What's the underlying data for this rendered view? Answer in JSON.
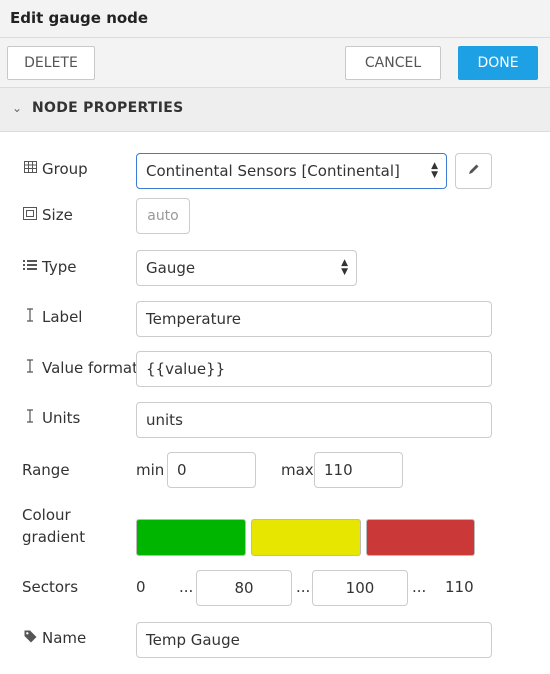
{
  "window": {
    "title": "Edit gauge node"
  },
  "toolbar": {
    "delete_label": "DELETE",
    "cancel_label": "CANCEL",
    "done_label": "DONE"
  },
  "section": {
    "title": "NODE PROPERTIES"
  },
  "group": {
    "label": "Group",
    "value": "Continental Sensors [Continental]"
  },
  "size": {
    "label": "Size",
    "value": "auto"
  },
  "type": {
    "label": "Type",
    "value": "Gauge"
  },
  "label_field": {
    "label": "Label",
    "value": "Temperature"
  },
  "value_format": {
    "label": "Value format",
    "value": "{{value}}"
  },
  "units": {
    "label": "Units",
    "value": "units"
  },
  "range": {
    "label": "Range",
    "min_label": "min",
    "min_value": "0",
    "max_label": "max",
    "max_value": "110"
  },
  "colour": {
    "label_line1": "Colour",
    "label_line2": "gradient",
    "colors": [
      "#00b500",
      "#e6e600",
      "#ca3838"
    ]
  },
  "sectors": {
    "label": "Sectors",
    "start": "0",
    "sep1": "...",
    "value1": "80",
    "sep2": "...",
    "value2": "100",
    "sep3": "...",
    "end": "110"
  },
  "name": {
    "label": "Name",
    "value": "Temp Gauge"
  }
}
